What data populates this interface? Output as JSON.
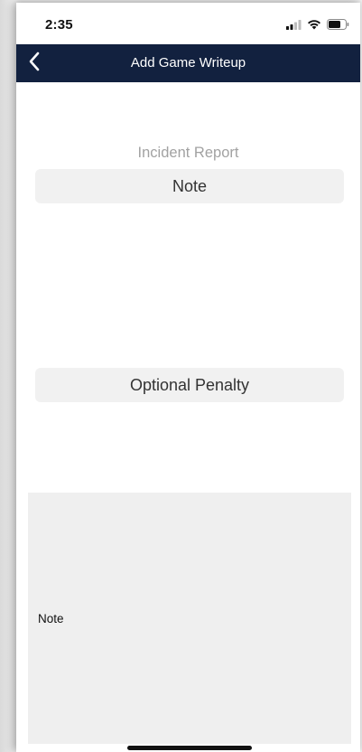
{
  "status_bar": {
    "time": "2:35",
    "signal_icon": "cellular-signal-icon",
    "wifi_icon": "wifi-icon",
    "battery_icon": "battery-icon"
  },
  "nav": {
    "back_icon": "chevron-left-icon",
    "title": "Add Game Writeup"
  },
  "form": {
    "section_label": "Incident Report",
    "note_button_label": "Note",
    "penalty_button_label": "Optional Penalty",
    "note_area_label": "Note"
  },
  "colors": {
    "nav_background": "#12213f",
    "field_background": "#f1f1f1",
    "note_area_background": "#efefef",
    "section_label": "#a2a2a2"
  }
}
